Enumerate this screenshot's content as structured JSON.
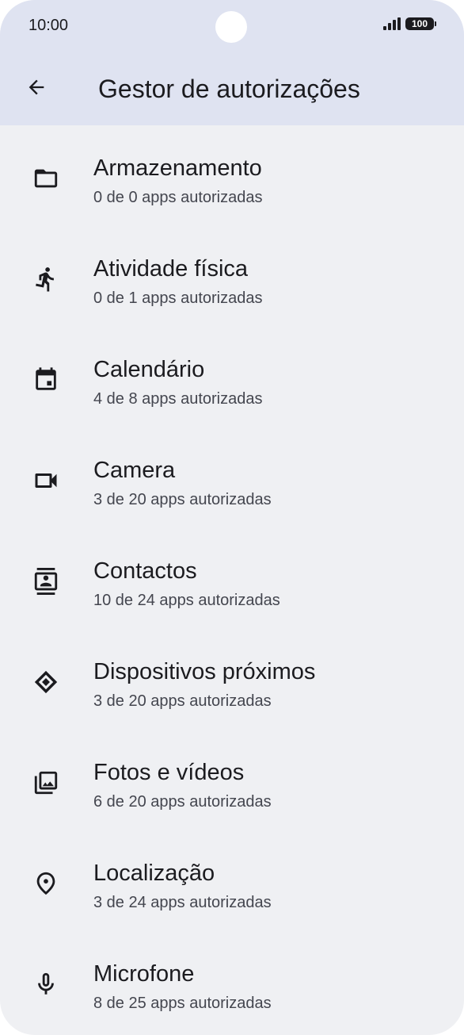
{
  "status": {
    "time": "10:00",
    "battery": "100"
  },
  "header": {
    "title": "Gestor de autorizações"
  },
  "items": [
    {
      "label": "Armazenamento",
      "sub": "0 de 0 apps autorizadas",
      "icon": "folder-icon"
    },
    {
      "label": "Atividade física",
      "sub": "0 de 1 apps autorizadas",
      "icon": "running-icon"
    },
    {
      "label": "Calendário",
      "sub": "4 de 8 apps autorizadas",
      "icon": "calendar-icon"
    },
    {
      "label": "Camera",
      "sub": "3 de 20 apps autorizadas",
      "icon": "video-camera-icon"
    },
    {
      "label": "Contactos",
      "sub": "10 de 24 apps autorizadas",
      "icon": "contacts-icon"
    },
    {
      "label": "Dispositivos próximos",
      "sub": "3 de 20 apps autorizadas",
      "icon": "nearby-devices-icon"
    },
    {
      "label": "Fotos e vídeos",
      "sub": "6 de 20 apps autorizadas",
      "icon": "photo-library-icon"
    },
    {
      "label": "Localização",
      "sub": "3 de 24 apps autorizadas",
      "icon": "location-pin-icon"
    },
    {
      "label": "Microfone",
      "sub": "8 de 25 apps autorizadas",
      "icon": "microphone-icon"
    }
  ],
  "colors": {
    "header_bg": "#dfe3f1",
    "page_bg": "#eff0f3",
    "text": "#1b1b1f",
    "subtext": "#44464f"
  }
}
